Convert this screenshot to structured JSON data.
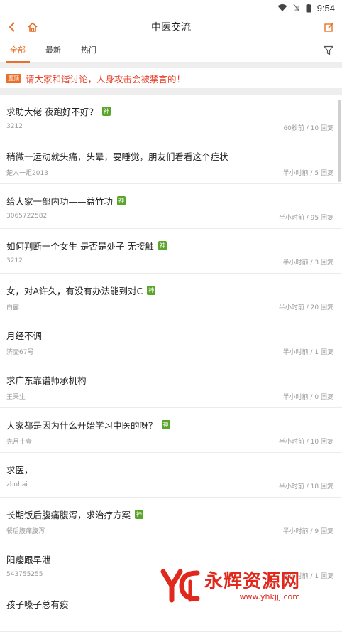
{
  "status_bar": {
    "time": "9:54"
  },
  "header": {
    "title": "中医交流"
  },
  "tabs": [
    {
      "label": "全部",
      "active": true
    },
    {
      "label": "最新",
      "active": false
    },
    {
      "label": "热门",
      "active": false
    }
  ],
  "notice": {
    "badge": "置顶",
    "text": "请大家和谐讨论，人身攻击会被禁言的！"
  },
  "posts": [
    {
      "title": "求助大佬 夜跑好不好？",
      "god": "神",
      "author": "3212",
      "time": "60秒前",
      "replies": "10 回复"
    },
    {
      "title": "稍微一运动就头痛，头晕，要睡觉，朋友们看看这个症状",
      "god": "",
      "author": "楚人一炬2013",
      "time": "半小时前",
      "replies": "5 回复"
    },
    {
      "title": "给大家一部内功——益竹功",
      "god": "神",
      "author": "3065722582",
      "time": "半小时前",
      "replies": "95 回复"
    },
    {
      "title": "如何判断一个女生 是否是处子 无接触",
      "god": "神",
      "author": "3212",
      "time": "半小时前",
      "replies": "3 回复"
    },
    {
      "title": "女，对A许久，有没有办法能到对C",
      "god": "神",
      "author": "白露",
      "time": "半小时前",
      "replies": "20 回复"
    },
    {
      "title": "月经不调",
      "god": "",
      "author": "济壶67号",
      "time": "半小时前",
      "replies": "1 回复"
    },
    {
      "title": "求广东靠谱师承机构",
      "god": "",
      "author": "王秉生",
      "time": "半小时前",
      "replies": "0 回复"
    },
    {
      "title": "大家都是因为什么开始学习中医的呀？",
      "god": "神",
      "author": "壳月十壹",
      "time": "半小时前",
      "replies": "10 回复"
    },
    {
      "title": "求医，",
      "god": "",
      "author": "zhuhai",
      "time": "半小时前",
      "replies": "18 回复"
    },
    {
      "title": "长期饭后腹痛腹泻，求治疗方案",
      "god": "神",
      "author": "餐后腹痛腹泻",
      "time": "半小时前",
      "replies": "9 回复"
    },
    {
      "title": "阳痿跟早泄",
      "god": "",
      "author": "543755255",
      "time": "半小时前",
      "replies": "1 回复"
    },
    {
      "title": "孩子嗓子总有痰",
      "god": "",
      "author": "",
      "time": "",
      "replies": ""
    }
  ],
  "watermark": {
    "brand": "永辉资源网",
    "url": "www.yhkjjj.com"
  },
  "colors": {
    "accent": "#e8702a",
    "god_badge": "#5aa62a",
    "notice_text": "#e8402a"
  }
}
